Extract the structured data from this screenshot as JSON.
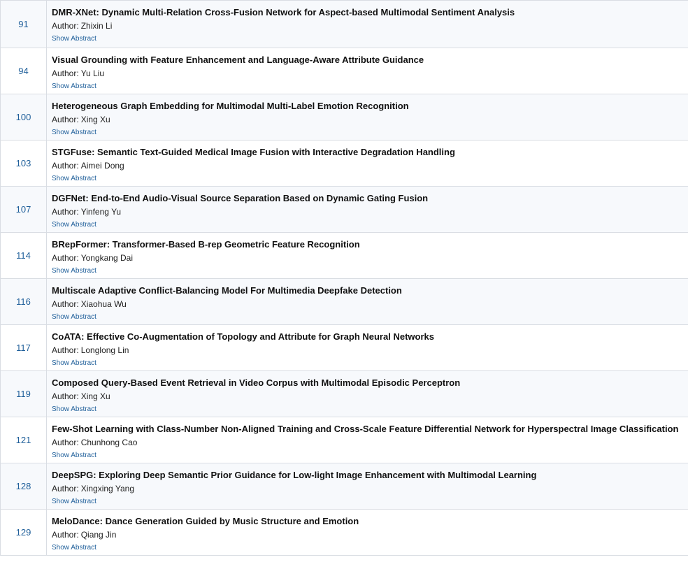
{
  "papers": [
    {
      "id": "91",
      "title": "DMR-XNet: Dynamic Multi-Relation Cross-Fusion Network for Aspect-based Multimodal Sentiment Analysis",
      "author": "Zhixin Li"
    },
    {
      "id": "94",
      "title": "Visual Grounding with Feature Enhancement and Language-Aware Attribute Guidance",
      "author": "Yu Liu"
    },
    {
      "id": "100",
      "title": "Heterogeneous Graph Embedding for Multimodal Multi-Label Emotion Recognition",
      "author": "Xing Xu"
    },
    {
      "id": "103",
      "title": "STGFuse: Semantic Text-Guided Medical Image Fusion with Interactive Degradation Handling",
      "author": "Aimei Dong"
    },
    {
      "id": "107",
      "title": "DGFNet: End-to-End Audio-Visual Source Separation Based on Dynamic Gating Fusion",
      "author": "Yinfeng Yu"
    },
    {
      "id": "114",
      "title": "BRepFormer: Transformer-Based B-rep Geometric Feature Recognition",
      "author": "Yongkang Dai"
    },
    {
      "id": "116",
      "title": "Multiscale Adaptive Conflict-Balancing Model For Multimedia Deepfake Detection",
      "author": "Xiaohua Wu"
    },
    {
      "id": "117",
      "title": "CoATA: Effective Co-Augmentation of Topology and Attribute for Graph Neural Networks",
      "author": "Longlong Lin"
    },
    {
      "id": "119",
      "title": "Composed Query-Based Event Retrieval in Video Corpus with Multimodal Episodic Perceptron",
      "author": "Xing Xu"
    },
    {
      "id": "121",
      "title": "Few-Shot Learning with Class-Number Non-Aligned Training and Cross-Scale Feature Differential Network for Hyperspectral Image Classification",
      "author": "Chunhong Cao"
    },
    {
      "id": "128",
      "title": "DeepSPG: Exploring Deep Semantic Prior Guidance for Low-light Image Enhancement with Multimodal Learning",
      "author": "Xingxing Yang"
    },
    {
      "id": "129",
      "title": "MeloDance: Dance Generation Guided by Music Structure and Emotion",
      "author": "Qiang Jin"
    }
  ],
  "labels": {
    "author_prefix": "Author:",
    "show_abstract": "Show Abstract"
  },
  "colors": {
    "link": "#1f5f9a",
    "row_alt": "#f7f9fc",
    "border": "#d9dde3"
  }
}
